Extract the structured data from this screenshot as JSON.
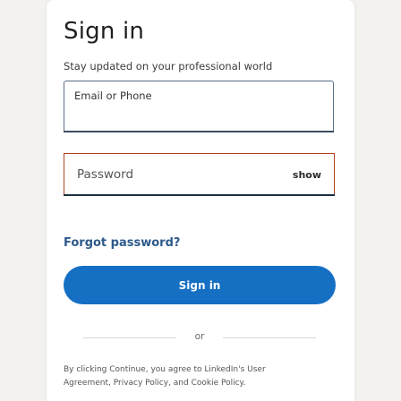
{
  "header": {
    "title": "Sign in",
    "subtitle": "Stay updated on your professional world"
  },
  "form": {
    "email_label": "Email or Phone",
    "password_label": "Password",
    "show_label": "show",
    "forgot_label": "Forgot password?",
    "submit_label": "Sign in"
  },
  "divider": {
    "or_label": "or"
  },
  "terms": {
    "prefix": "By clicking Continue, you agree to LinkedIn's User",
    "user_agreement": "Agreement",
    "sep1": ", ",
    "privacy": "Privacy Policy",
    "sep2": ", and ",
    "cookie": "Cookie Policy",
    "suffix": "."
  },
  "colors": {
    "accent": "#1570c4",
    "link": "#2d5a8a",
    "error_border": "#b24020"
  }
}
